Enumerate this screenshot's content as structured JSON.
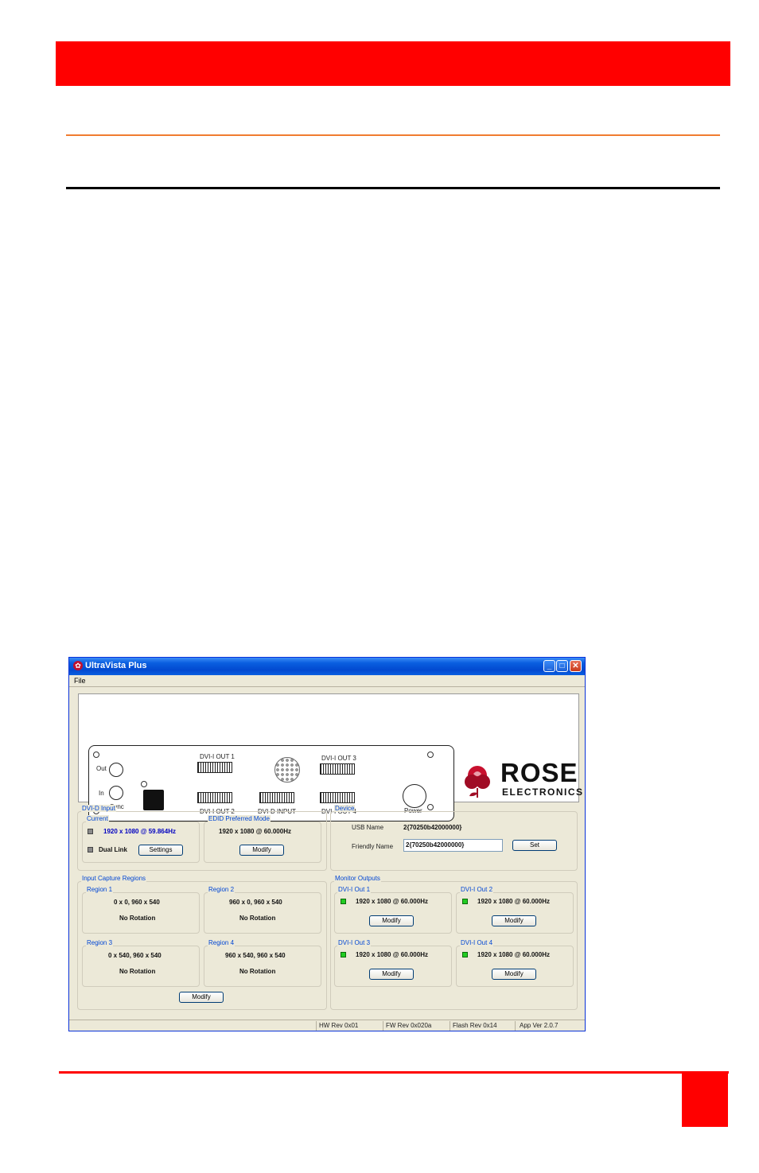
{
  "window": {
    "title": "UltraVista Plus",
    "menu": {
      "file": "File"
    }
  },
  "rear_panel": {
    "out": "Out",
    "in": "In",
    "sync": "Sync",
    "dvi_out_1": "DVI-I OUT 1",
    "dvi_out_2": "DVI-I OUT 2",
    "dvi_out_3": "DVI-I OUT 3",
    "dvi_out_4": "DVI-I OUT 4",
    "dvi_input": "DVI-D INPUT",
    "power": "Power"
  },
  "logo": {
    "rose": "ROSE",
    "electronics": "ELECTRONICS"
  },
  "dvi_input": {
    "group": "DVI-D Input",
    "current_label": "Current",
    "current_value": "1920 x 1080 @ 59.864Hz",
    "dual_link": "Dual Link",
    "settings": "Settings",
    "edid_label": "EDID Preferred Mode",
    "edid_value": "1920 x 1080 @ 60.000Hz",
    "modify": "Modify"
  },
  "device": {
    "group": "Device",
    "usb_name_label": "USB Name",
    "usb_name_value": "2{70250b42000000}",
    "friendly_name_label": "Friendly Name",
    "friendly_name_value": "2{70250b42000000}",
    "set": "Set"
  },
  "capture": {
    "group": "Input Capture Regions",
    "regions": [
      {
        "label": "Region 1",
        "coords": "0 x 0, 960 x 540",
        "rotation": "No Rotation"
      },
      {
        "label": "Region 2",
        "coords": "960 x 0, 960 x 540",
        "rotation": "No Rotation"
      },
      {
        "label": "Region 3",
        "coords": "0 x 540, 960 x 540",
        "rotation": "No Rotation"
      },
      {
        "label": "Region 4",
        "coords": "960 x 540, 960 x 540",
        "rotation": "No Rotation"
      }
    ],
    "modify": "Modify"
  },
  "monitors": {
    "group": "Monitor Outputs",
    "outputs": [
      {
        "label": "DVI-I Out 1",
        "mode": "1920 x 1080 @ 60.000Hz",
        "modify": "Modify"
      },
      {
        "label": "DVI-I Out 2",
        "mode": "1920 x 1080 @ 60.000Hz",
        "modify": "Modify"
      },
      {
        "label": "DVI-I Out 3",
        "mode": "1920 x 1080 @ 60.000Hz",
        "modify": "Modify"
      },
      {
        "label": "DVI-I Out 4",
        "mode": "1920 x 1080 @ 60.000Hz",
        "modify": "Modify"
      }
    ]
  },
  "status": {
    "hw": "HW Rev 0x01",
    "fw": "FW Rev 0x020a",
    "flash": "Flash Rev 0x14",
    "app": "App Ver 2.0.7"
  },
  "colors": {
    "accent_red": "#ff0000",
    "rule_orange": "#f07c30",
    "title_blue": "#0a5fe0",
    "led_green": "#22cc22"
  }
}
